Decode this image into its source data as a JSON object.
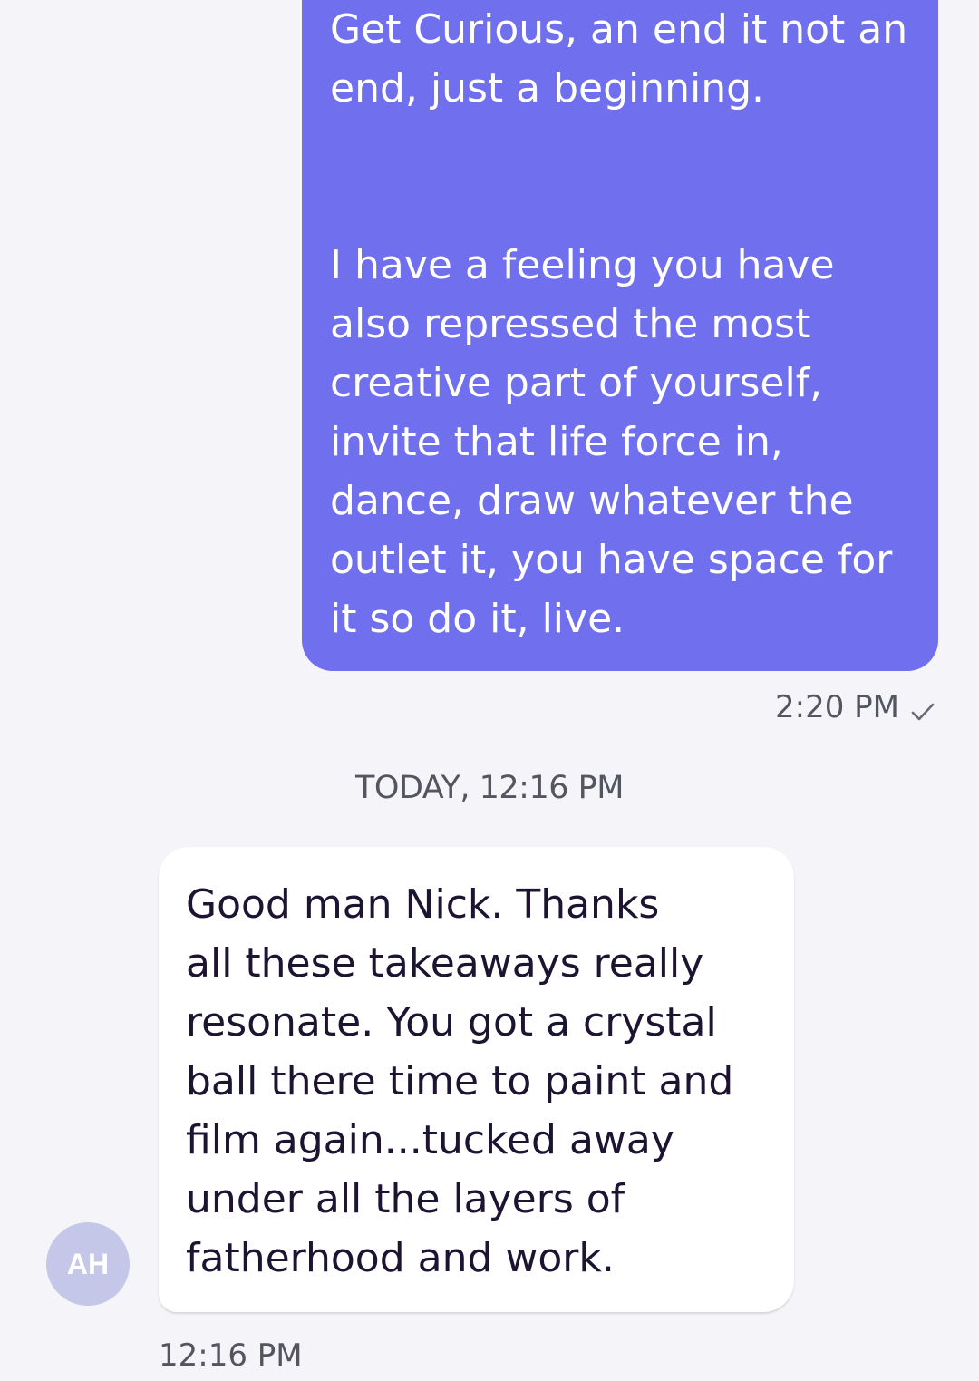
{
  "outgoing_message": {
    "paragraph_1": "Get Curious, an end it not an\nend, just a beginning.",
    "paragraph_2": "I have a feeling you have\nalso repressed the most\ncreative part of yourself,\ninvite that life force in,\ndance, draw whatever the\noutlet it, you have space for\nit so do it, live.",
    "time": "2:20 PM",
    "status_icon": "check-icon",
    "bubble_color": "#7070ee"
  },
  "date_divider": "TODAY, 12:16 PM",
  "incoming_message": {
    "avatar_initials": "AH",
    "text": "Good man Nick. Thanks\nall these takeaways really\nresonate. You got a crystal\nball there time to paint and\nfilm again...tucked away\nunder all the layers of\nfatherhood and work.",
    "time": "12:16 PM",
    "bubble_color": "#ffffff"
  }
}
